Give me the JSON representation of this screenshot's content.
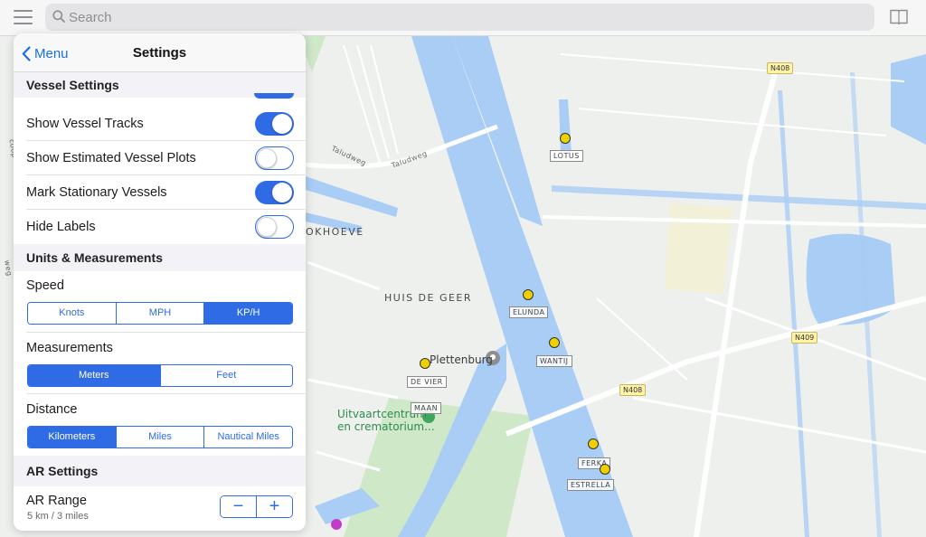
{
  "search": {
    "placeholder": "Search"
  },
  "panel": {
    "back_label": "Menu",
    "title": "Settings",
    "vessel_settings": {
      "header": "Vessel Settings",
      "rows": [
        {
          "label": "Show Vessel Tracks",
          "on": true
        },
        {
          "label": "Show Estimated Vessel Plots",
          "on": false
        },
        {
          "label": "Mark Stationary Vessels",
          "on": true
        },
        {
          "label": "Hide Labels",
          "on": false
        }
      ]
    },
    "units": {
      "header": "Units & Measurements",
      "speed": {
        "label": "Speed",
        "options": [
          "Knots",
          "MPH",
          "KP/H"
        ],
        "selected": 2
      },
      "measurements": {
        "label": "Measurements",
        "options": [
          "Meters",
          "Feet"
        ],
        "selected": 0
      },
      "distance": {
        "label": "Distance",
        "options": [
          "Kilometers",
          "Miles",
          "Nautical Miles"
        ],
        "selected": 0
      }
    },
    "ar": {
      "header": "AR Settings",
      "range_label": "AR Range",
      "range_value": "5 km / 3 miles",
      "minus": "−",
      "plus": "+"
    }
  },
  "map": {
    "places": {
      "huis_de_geer": "HUIS DE GEER",
      "okhoeve": "OKHOEVE"
    },
    "roads": {
      "taludweg_1": "Taludweg",
      "taludweg_2": "Taludweg",
      "coop": "coop",
      "weg": "weg"
    },
    "badges": {
      "n408_top": "N408",
      "n409": "N409",
      "n408_mid": "N408"
    },
    "poi": {
      "plettenburg": "Plettenburg",
      "uitvaart_line1": "Uitvaartcentrum",
      "uitvaart_line2": "en crematorium..."
    },
    "vessels": {
      "lotus": "LOTUS",
      "elunda": "ELUNDA",
      "wantij": "WANTIJ",
      "de_vier": "DE VIER",
      "maan": "MAAN",
      "ferka": "FERKA",
      "estrella": "ESTRELLA"
    },
    "colors": {
      "water": "#a9cdf5",
      "land": "#eef0ee",
      "green": "#cfe8c8",
      "accent": "#2f6be5"
    }
  }
}
